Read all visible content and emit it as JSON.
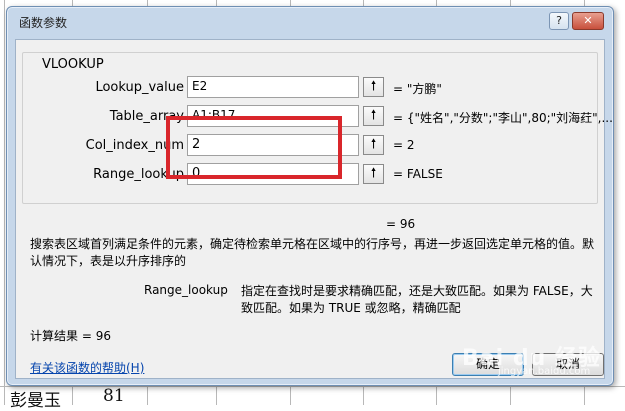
{
  "dialog": {
    "title": "函数参数",
    "help_button": "?",
    "close_button": "✕",
    "function_name": "VLOOKUP"
  },
  "args": [
    {
      "label": "Lookup_value",
      "value": "E2",
      "result": "\"方鹏\""
    },
    {
      "label": "Table_array",
      "value": "A1:B17",
      "result": "{\"姓名\",\"分数\";\"李山\",80;\"刘海荭\",..."
    },
    {
      "label": "Col_index_num",
      "value": "2",
      "result": "2"
    },
    {
      "label": "Range_lookup",
      "value": "0",
      "result": "FALSE"
    }
  ],
  "equals_sign": "=",
  "function_result": "96",
  "description": "搜索表区域首列满足条件的元素，确定待检索单元格在区域中的行序号，再进一步返回选定单元格的值。默认情况下，表是以升序排序的",
  "arg_help": {
    "name": "Range_lookup",
    "text": "指定在查找时是要求精确匹配，还是大致匹配。如果为 FALSE，大致匹配。如果为 TRUE 或忽略，精确匹配"
  },
  "calc_result_label": "计算结果 =",
  "calc_result_value": "96",
  "help_link": "有关该函数的帮助(H)",
  "ok_button": "确定",
  "cancel_button": "取消",
  "sheet": {
    "cell_name": "彭曼玉",
    "cell_score": "81"
  },
  "watermark": "Bai du 经验",
  "watermark_sub": "jingyan.baidu.com",
  "colors": {
    "dialog_frame": "#c6d7ea",
    "client": "#f0f0f0",
    "highlight": "#d9262b",
    "link": "#0645ad"
  }
}
